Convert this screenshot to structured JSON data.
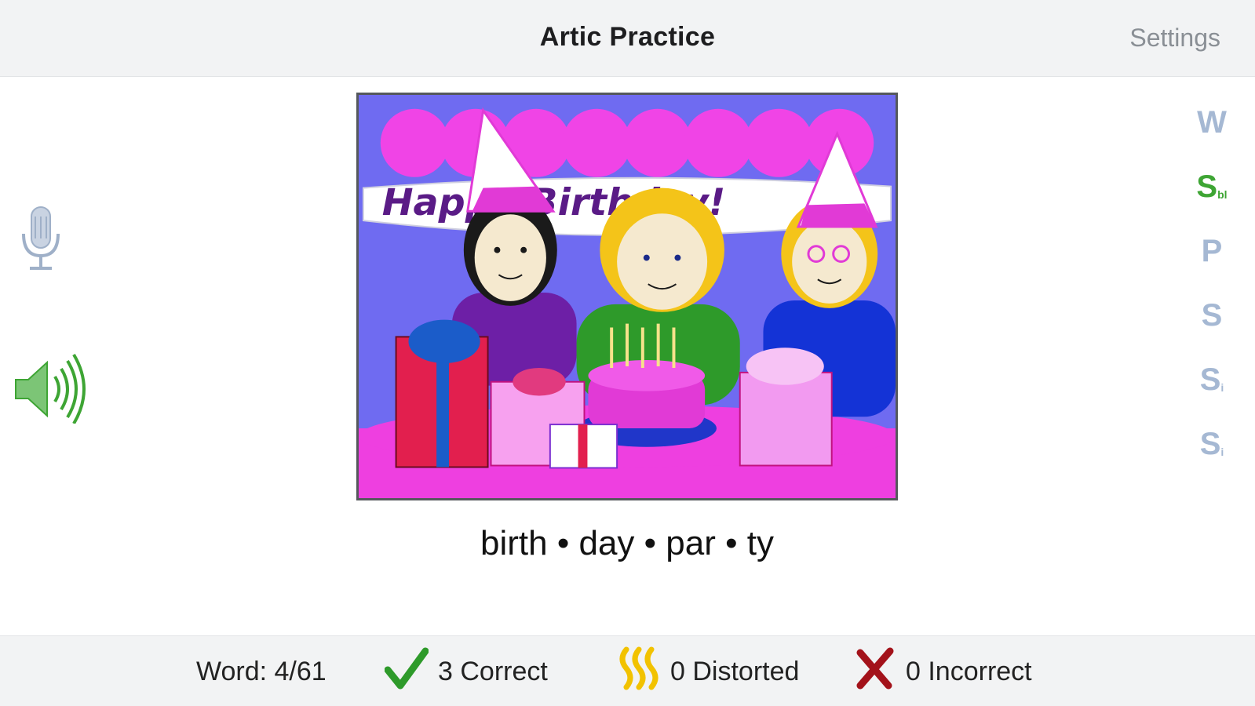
{
  "header": {
    "title": "Artic Practice",
    "settings_label": "Settings"
  },
  "card": {
    "image_alt": "birthday party",
    "word": "birth • day • par • ty",
    "banner_text": "Happy Birthday!"
  },
  "tools": {
    "mic_icon": "microphone-icon",
    "speaker_icon": "speaker-icon"
  },
  "sounds": [
    {
      "letter": "W",
      "sub": "",
      "active": false
    },
    {
      "letter": "S",
      "sub": "bl",
      "active": true
    },
    {
      "letter": "P",
      "sub": "",
      "active": false
    },
    {
      "letter": "S",
      "sub": "",
      "active": false
    },
    {
      "letter": "S",
      "sub": "i",
      "active": false
    },
    {
      "letter": "S",
      "sub": "i",
      "active": false
    }
  ],
  "scores": {
    "word_label": "Word: 4/61",
    "correct_label": "3 Correct",
    "distorted_label": "0 Distorted",
    "incorrect_label": "0 Incorrect"
  },
  "colors": {
    "correct": "#2e9a2a",
    "distorted": "#f2c200",
    "incorrect": "#a3121a",
    "active_sound": "#3ea534",
    "inactive_sound": "#a5b8d3"
  }
}
